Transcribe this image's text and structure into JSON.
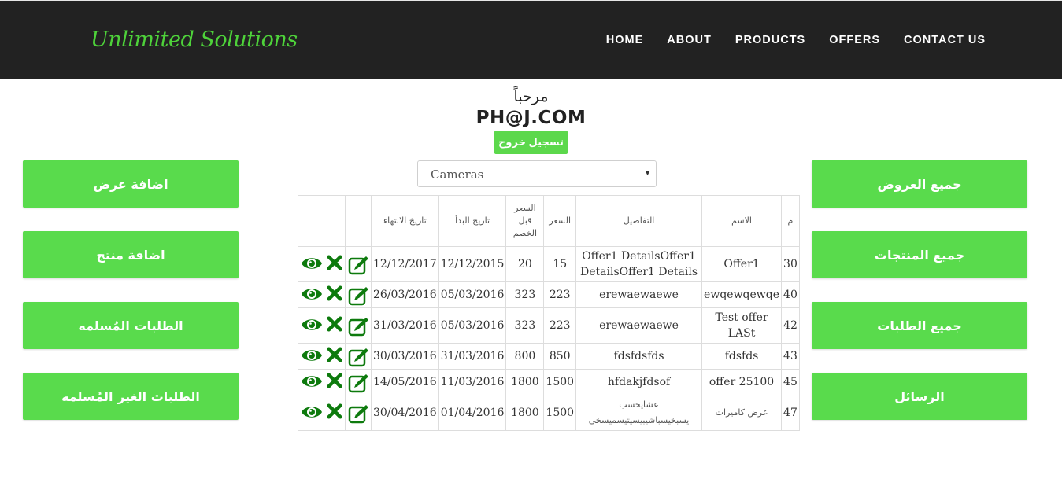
{
  "brand": "Unlimited Solutions",
  "nav": [
    "HOME",
    "ABOUT",
    "PRODUCTS",
    "OFFERS",
    "CONTACT US"
  ],
  "welcome": {
    "greeting": "مرحباً",
    "user": "PH@J.COM",
    "logout_label": "تسجيل خروج"
  },
  "left_buttons": [
    "اضافة عرض",
    "اضافة منتج",
    "الطلبات المُسلمه",
    "الطلبات الغير المُسلمه"
  ],
  "right_buttons": [
    "جميع العروض",
    "جميع المنتجات",
    "جميع الطلبات",
    "الرسائل"
  ],
  "category_select": {
    "selected": "Cameras"
  },
  "table": {
    "headers": {
      "num": "م",
      "name": "الاسم",
      "details": "التفاصيل",
      "price": "السعر",
      "price_before": "السعر قبل الخصم",
      "start_date": "تاريخ البدأ",
      "end_date": "تاريخ الانتهاء"
    },
    "rows": [
      {
        "num": "30",
        "name": "Offer1",
        "details": "Offer1 DetailsOffer1 DetailsOffer1 Details",
        "price": "15",
        "price_before": "20",
        "start_date": "12/12/2015",
        "end_date": "12/12/2017"
      },
      {
        "num": "40",
        "name": "ewqewqewqe",
        "details": "erewaewaewe",
        "price": "223",
        "price_before": "323",
        "start_date": "05/03/2016",
        "end_date": "26/03/2016"
      },
      {
        "num": "42",
        "name": "Test offer LASt",
        "details": "erewaewaewe",
        "price": "223",
        "price_before": "323",
        "start_date": "05/03/2016",
        "end_date": "31/03/2016"
      },
      {
        "num": "43",
        "name": "fdsfds",
        "details": "fdsfdsfds",
        "price": "850",
        "price_before": "800",
        "start_date": "31/03/2016",
        "end_date": "30/03/2016"
      },
      {
        "num": "45",
        "name": "offer 25100",
        "details": "hfdakjfdsof",
        "price": "1500",
        "price_before": "1800",
        "start_date": "11/03/2016",
        "end_date": "14/05/2016"
      },
      {
        "num": "47",
        "name": "عرض كاميرات",
        "details": "عشايخسب يسبخيسباشيبيسيتيسميسخي",
        "price": "1500",
        "price_before": "1800",
        "start_date": "01/04/2016",
        "end_date": "30/04/2016"
      }
    ]
  },
  "icons": {
    "view": "eye-icon",
    "delete": "close-icon",
    "edit": "edit-icon",
    "color": "#0d7a0d"
  }
}
